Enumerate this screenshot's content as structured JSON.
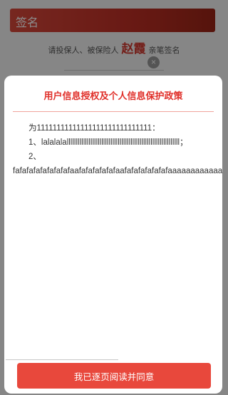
{
  "background": {
    "header_title": "签名",
    "instruction_prefix": "请投保人、被保险人",
    "signer_name": "赵霞",
    "instruction_suffix": "亲笔签名",
    "clear_icon": "×"
  },
  "modal": {
    "title": "用户信息授权及个人信息保护政策",
    "paragraphs": [
      "为11111111111111111111111111111：",
      "1、lalalalallllllllllllllllllllllllllllllllllllllllllllllllllllllllllllll；",
      "2、",
      "fafafafafafafafafaafafafafafafaafafafafafafafaaaaaaaaaaaaaa"
    ],
    "agree_button": "我已逐页阅读并同意"
  },
  "colors": {
    "accent": "#e0302a",
    "button": "#e8483c"
  }
}
